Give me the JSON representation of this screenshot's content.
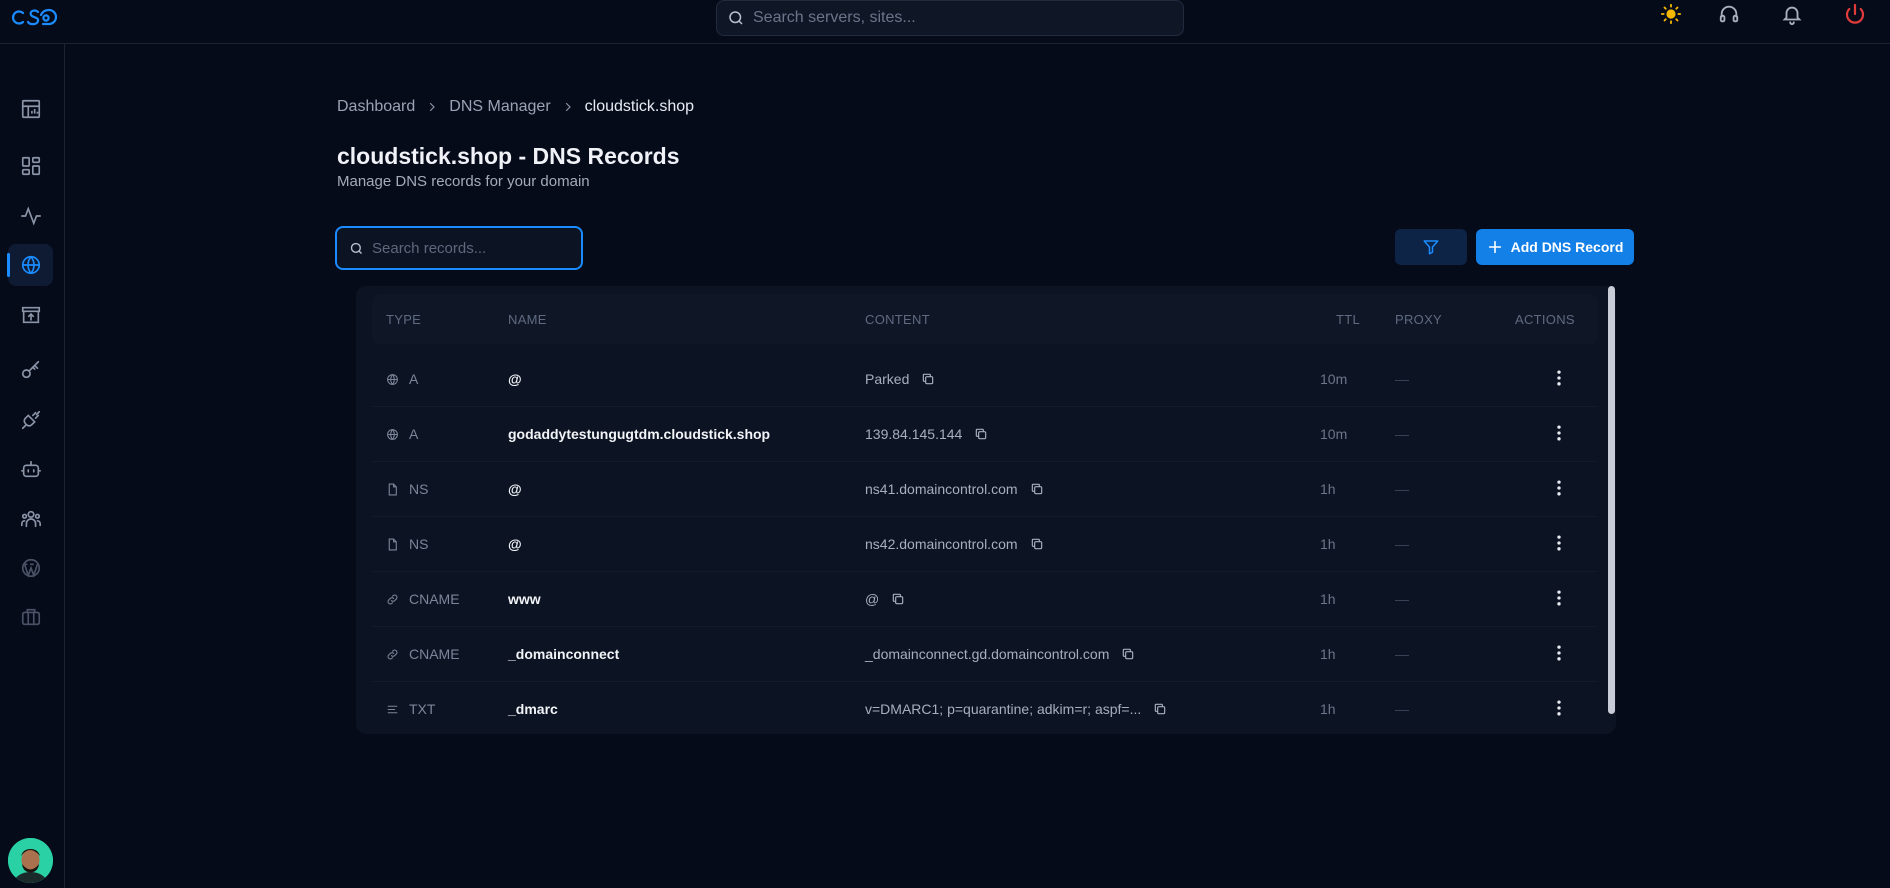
{
  "header": {
    "search_placeholder": "Search servers, sites...",
    "icons": [
      "sun-icon",
      "headset-icon",
      "bell-icon",
      "power-icon"
    ]
  },
  "sidebar": {
    "items": [
      {
        "name": "dashboard-icon"
      },
      {
        "name": "grid-icon"
      },
      {
        "name": "activity-icon"
      },
      {
        "name": "globe-icon",
        "active": true
      },
      {
        "name": "store-icon"
      },
      {
        "name": "key-icon"
      },
      {
        "name": "plug-icon"
      },
      {
        "name": "bot-icon"
      },
      {
        "name": "team-icon"
      },
      {
        "name": "wordpress-icon"
      },
      {
        "name": "briefcase-icon"
      }
    ]
  },
  "breadcrumb": [
    "Dashboard",
    "DNS Manager",
    "cloudstick.shop"
  ],
  "page": {
    "title": "cloudstick.shop - DNS Records",
    "subtitle": "Manage DNS records for your domain"
  },
  "toolbar": {
    "search_placeholder": "Search records...",
    "add_label": "Add DNS Record"
  },
  "table": {
    "columns": [
      "TYPE",
      "NAME",
      "CONTENT",
      "TTL",
      "PROXY",
      "ACTIONS"
    ],
    "rows": [
      {
        "icon": "globe-icon",
        "type": "A",
        "name": "@",
        "content": "Parked",
        "ttl": "10m",
        "proxy": "—"
      },
      {
        "icon": "globe-icon",
        "type": "A",
        "name": "godaddytestungugtdm.cloudstick.shop",
        "content": "139.84.145.144",
        "ttl": "10m",
        "proxy": "—"
      },
      {
        "icon": "file-icon",
        "type": "NS",
        "name": "@",
        "content": "ns41.domaincontrol.com",
        "ttl": "1h",
        "proxy": "—"
      },
      {
        "icon": "file-icon",
        "type": "NS",
        "name": "@",
        "content": "ns42.domaincontrol.com",
        "ttl": "1h",
        "proxy": "—"
      },
      {
        "icon": "link-icon",
        "type": "CNAME",
        "name": "www",
        "content": "@",
        "ttl": "1h",
        "proxy": "—"
      },
      {
        "icon": "link-icon",
        "type": "CNAME",
        "name": "_domainconnect",
        "content": "_domainconnect.gd.domaincontrol.com",
        "ttl": "1h",
        "proxy": "—"
      },
      {
        "icon": "text-icon",
        "type": "TXT",
        "name": "_dmarc",
        "content": "v=DMARC1; p=quarantine; adkim=r; aspf=...",
        "ttl": "1h",
        "proxy": "—"
      }
    ]
  },
  "colors": {
    "background": "#060b1a",
    "accent": "#1a8cff",
    "button": "#1380e8",
    "danger": "#e23b3b",
    "sun": "#f5b800"
  }
}
